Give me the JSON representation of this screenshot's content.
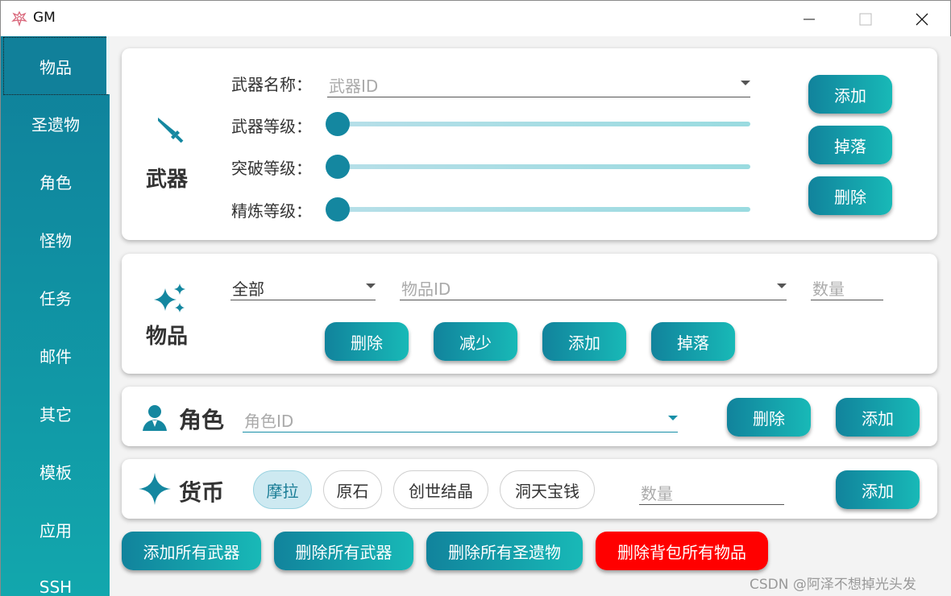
{
  "window": {
    "title": "GM",
    "app_icon": "dragon-logo-icon"
  },
  "sidebar": {
    "items": [
      {
        "label": "物品",
        "active": true
      },
      {
        "label": "圣遗物"
      },
      {
        "label": "角色"
      },
      {
        "label": "怪物"
      },
      {
        "label": "任务"
      },
      {
        "label": "邮件"
      },
      {
        "label": "其它"
      },
      {
        "label": "模板"
      },
      {
        "label": "应用"
      },
      {
        "label": "SSH"
      }
    ]
  },
  "weapon": {
    "title": "武器",
    "icon": "sword-icon",
    "name_label": "武器名称：",
    "name_placeholder": "武器ID",
    "level_label": "武器等级：",
    "ascension_label": "突破等级：",
    "refine_label": "精炼等级：",
    "add_button": "添加",
    "drop_button": "掉落",
    "delete_button": "删除"
  },
  "item": {
    "title": "物品",
    "icon": "sparkles-icon",
    "category_value": "全部",
    "id_placeholder": "物品ID",
    "quantity_placeholder": "数量",
    "delete_button": "删除",
    "reduce_button": "减少",
    "add_button": "添加",
    "drop_button": "掉落"
  },
  "role": {
    "title": "角色",
    "icon": "user-icon",
    "id_placeholder": "角色ID",
    "delete_button": "删除",
    "add_button": "添加"
  },
  "currency": {
    "title": "货币",
    "icon": "star-icon",
    "chips": [
      "摩拉",
      "原石",
      "创世结晶",
      "洞天宝钱"
    ],
    "selected": "摩拉",
    "quantity_placeholder": "数量",
    "add_button": "添加"
  },
  "bottom_actions": {
    "add_all_weapons": "添加所有武器",
    "delete_all_weapons": "删除所有武器",
    "delete_all_artifacts": "删除所有圣遗物",
    "delete_all_bag_items": "删除背包所有物品"
  },
  "watermark": "CSDN @阿泽不想掉光头发",
  "colors": {
    "accent": "#1487a0",
    "accent_light": "#18b9b7",
    "danger": "#ff0000"
  }
}
